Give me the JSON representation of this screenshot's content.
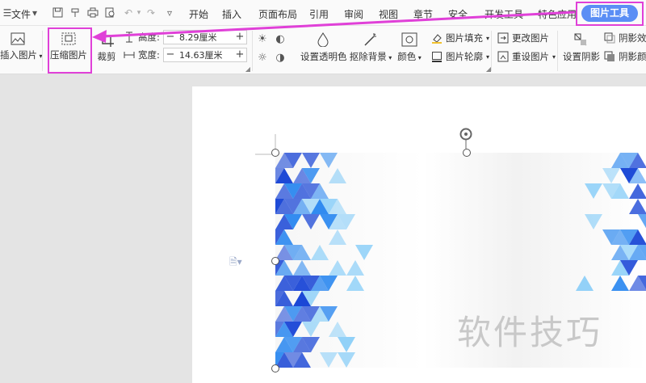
{
  "menu": {
    "file": "文件",
    "tabs": [
      "开始",
      "插入",
      "页面布局",
      "引用",
      "审阅",
      "视图",
      "章节",
      "安全",
      "开发工具",
      "特色应用"
    ],
    "active_tab": "图片工具"
  },
  "ribbon": {
    "insert_picture": "插入图片",
    "compress_picture": "压缩图片",
    "crop": "裁剪",
    "height_label": "高度:",
    "height_value": "8.29厘米",
    "width_label": "宽度:",
    "width_value": "14.63厘米",
    "set_transparent": "设置透明色",
    "remove_background": "抠除背景",
    "color": "颜色",
    "picture_fill": "图片填充",
    "picture_outline": "图片轮廓",
    "change_picture": "更改图片",
    "reset_picture": "重设图片",
    "set_shadow": "设置阴影",
    "shadow_effect": "阴影效果",
    "shadow_color": "阴影颜色"
  },
  "document": {
    "watermark": "软件技巧"
  },
  "colors": {
    "accent": "#5b8ef5",
    "highlight": "#e040d8",
    "tri_dark": "#1b47d6",
    "tri_mid": "#2f8af0",
    "tri_light": "#8fd0f8"
  }
}
